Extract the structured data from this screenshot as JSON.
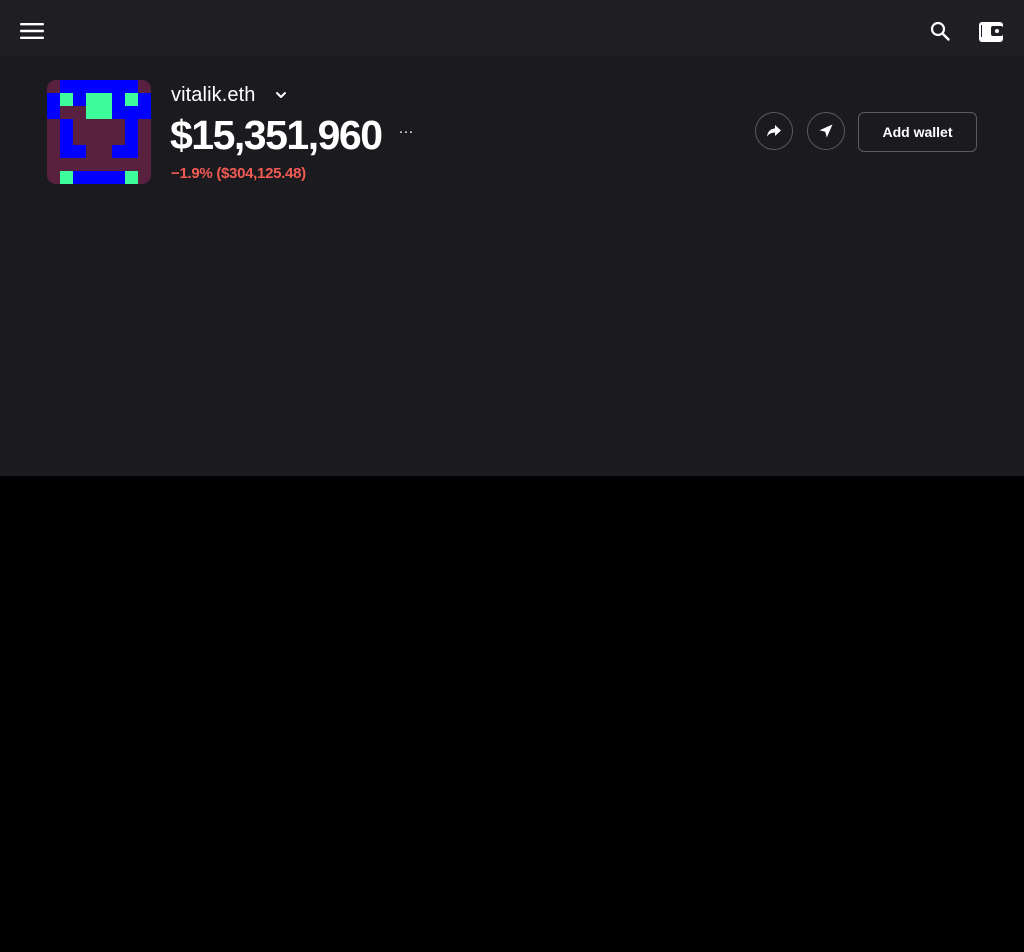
{
  "header": {
    "menu_icon": "hamburger-menu-icon",
    "search_icon": "search-icon",
    "wallet_icon": "wallet-icon"
  },
  "account": {
    "name": "vitalik.eth",
    "balance": "$15,351,960",
    "change": "−1.9% ($304,125.48)",
    "change_color": "#f25b54",
    "more_label": "···",
    "avatar_colors": {
      "background": "#5a2040",
      "blue": "#0000ff",
      "green": "#3dfc9c"
    }
  },
  "actions": {
    "share_icon": "share-icon",
    "send_icon": "send-icon",
    "add_wallet_label": "Add wallet"
  },
  "theme": {
    "topbar": "#1f1f23",
    "hero": "#1a1a1f",
    "page": "#000000"
  }
}
